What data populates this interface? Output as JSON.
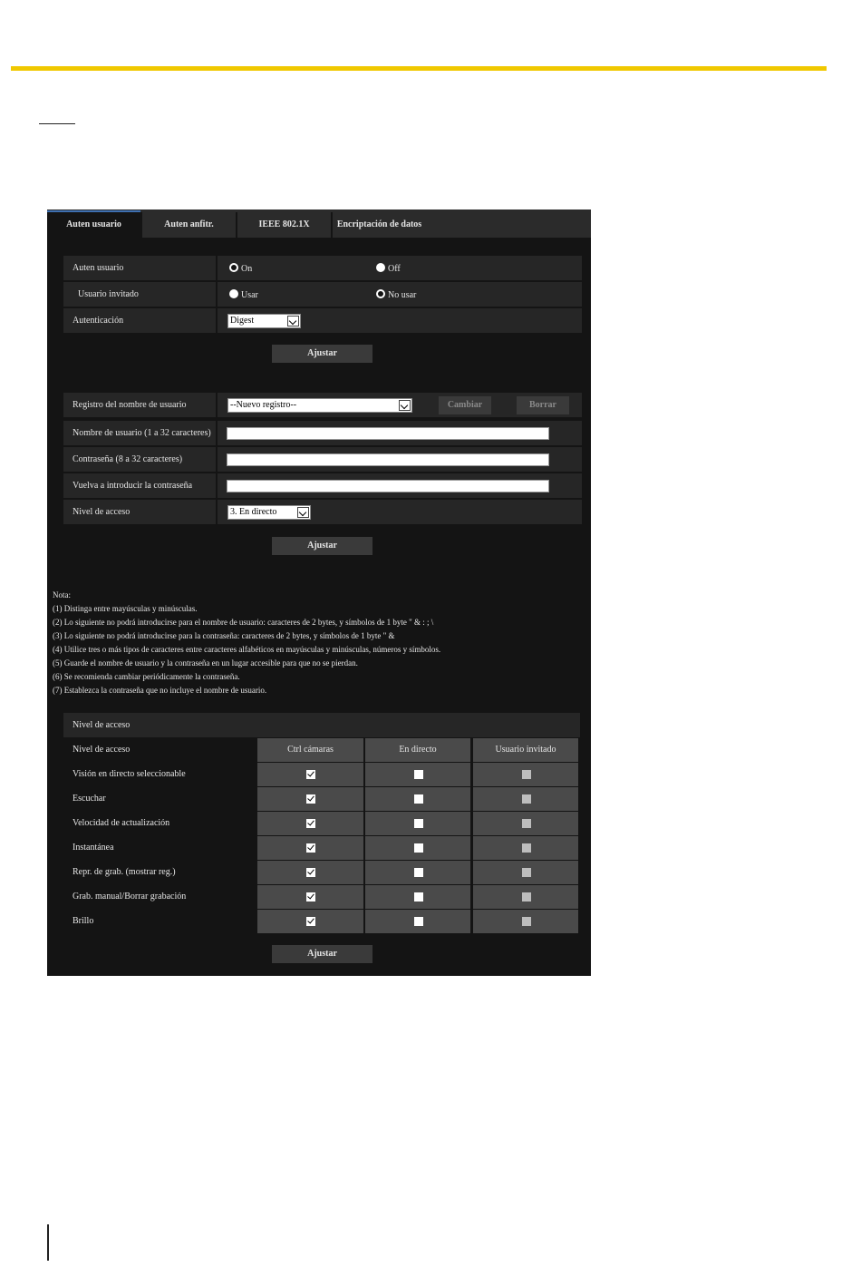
{
  "tabs": [
    "Auten usuario",
    "Auten anfitr.",
    "IEEE 802.1X",
    "Encriptación de datos"
  ],
  "auth": {
    "user_auth_label": "Auten usuario",
    "user_auth_on": "On",
    "user_auth_off": "Off",
    "guest_label": "Usuario invitado",
    "guest_use": "Usar",
    "guest_nouse": "No usar",
    "method_label": "Autenticación",
    "method_value": "Digest",
    "apply": "Ajustar"
  },
  "users": {
    "registry_label": "Registro del nombre de usuario",
    "registry_value": "--Nuevo registro--",
    "change": "Cambiar",
    "delete": "Borrar",
    "username_label": "Nombre de usuario (1 a 32 caracteres)",
    "password_label": "Contraseña (8 a 32 caracteres)",
    "retype_label": "Vuelva a introducir la contraseña",
    "level_label": "Nivel de acceso",
    "level_value": "3. En directo",
    "apply": "Ajustar"
  },
  "notes": [
    "Nota:",
    "(1) Distinga entre mayúsculas y minúsculas.",
    "(2) Lo siguiente no podrá introducirse para el nombre de usuario:   caracteres de 2 bytes, y símbolos de 1 byte \" & : ; \\",
    "(3) Lo siguiente no podrá introducirse para la contraseña:   caracteres de 2 bytes, y símbolos de 1 byte \" &",
    "(4) Utilice tres o más tipos de caracteres entre caracteres alfabéticos en mayúsculas y minúsculas, números y símbolos.",
    "(5) Guarde el nombre de usuario y la contraseña en un lugar accesible para que no se pierdan.",
    "(6) Se recomienda cambiar periódicamente la contraseña.",
    "(7) Establezca la contraseña que no incluye el nombre de usuario."
  ],
  "access_table": {
    "title": "Nivel de acceso",
    "header_label": "Nivel de acceso",
    "columns": [
      "Ctrl cámaras",
      "En directo",
      "Usuario invitado"
    ],
    "rows": [
      "Visión en directo seleccionable",
      "Escuchar",
      "Velocidad de actualización",
      "Instantánea",
      "Repr. de grab. (mostrar reg.)",
      "Grab. manual/Borrar grabación",
      "Brillo"
    ],
    "apply": "Ajustar"
  }
}
